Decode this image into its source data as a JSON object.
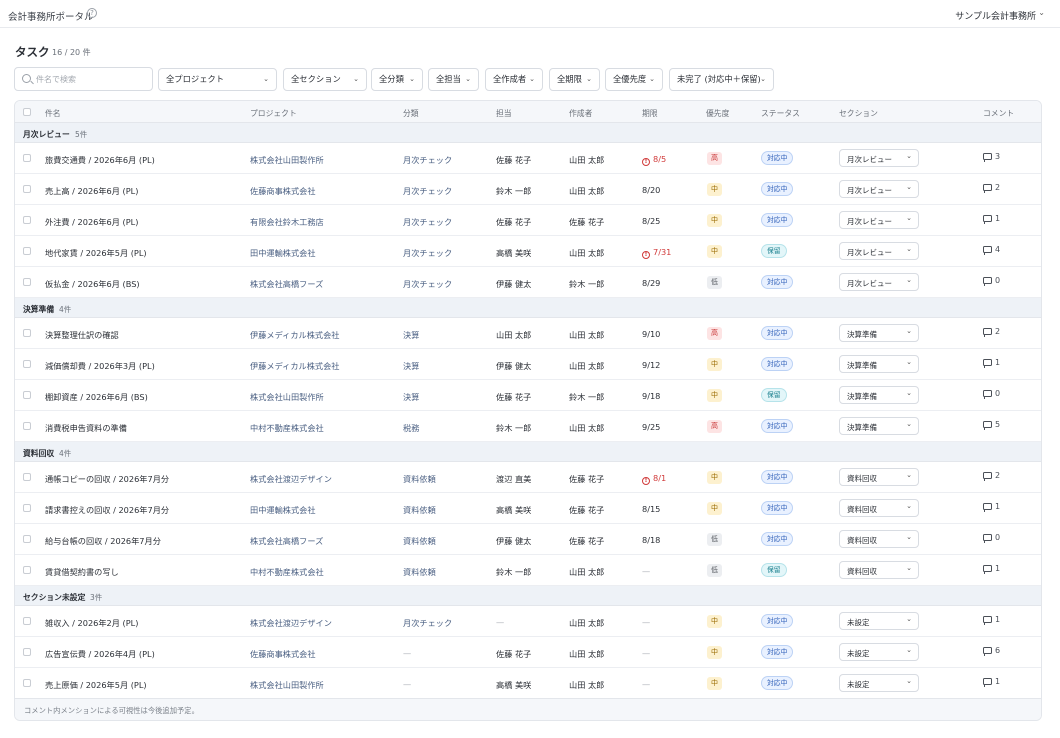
{
  "header": {
    "app_title": "会計事務所ポータル",
    "help_glyph": "?",
    "office_name": "サンプル会計事務所"
  },
  "page": {
    "title": "タスク",
    "count": "16 / 20 件"
  },
  "search": {
    "placeholder": "件名で検索",
    "value": ""
  },
  "filters": [
    {
      "label": "全プロジェクト"
    },
    {
      "label": "全セクション"
    },
    {
      "label": "全分類"
    },
    {
      "label": "全担当"
    },
    {
      "label": "全作成者"
    },
    {
      "label": "全期限"
    },
    {
      "label": "全優先度"
    },
    {
      "label": "未完了 (対応中＋保留)"
    }
  ],
  "columns": {
    "name": "件名",
    "project": "プロジェクト",
    "category": "分類",
    "assignee": "担当",
    "author": "作成者",
    "due": "期限",
    "priority": "優先度",
    "status": "ステータス",
    "section": "セクション",
    "comments": "コメント"
  },
  "groups": [
    {
      "label": "月次レビュー",
      "count": "5件",
      "rows": [
        {
          "name": "旅費交通費 / 2026年6月 (PL)",
          "project": "株式会社山田製作所",
          "category": "月次チェック",
          "assignee": "佐藤 花子",
          "author": "山田 太郎",
          "due": "8/5",
          "overdue": true,
          "priority": "高",
          "priority_level": "high",
          "status": "対応中",
          "status_type": "prog",
          "section": "月次レビュー",
          "comments": "3"
        },
        {
          "name": "売上高 / 2026年6月 (PL)",
          "project": "佐藤商事株式会社",
          "category": "月次チェック",
          "assignee": "鈴木 一郎",
          "author": "山田 太郎",
          "due": "8/20",
          "overdue": false,
          "priority": "中",
          "priority_level": "mid",
          "status": "対応中",
          "status_type": "prog",
          "section": "月次レビュー",
          "comments": "2"
        },
        {
          "name": "外注費 / 2026年6月 (PL)",
          "project": "有限会社鈴木工務店",
          "category": "月次チェック",
          "assignee": "佐藤 花子",
          "author": "佐藤 花子",
          "due": "8/25",
          "overdue": false,
          "priority": "中",
          "priority_level": "mid",
          "status": "対応中",
          "status_type": "prog",
          "section": "月次レビュー",
          "comments": "1"
        },
        {
          "name": "地代家賃 / 2026年5月 (PL)",
          "project": "田中運輸株式会社",
          "category": "月次チェック",
          "assignee": "高橋 美咲",
          "author": "山田 太郎",
          "due": "7/31",
          "overdue": true,
          "priority": "中",
          "priority_level": "mid",
          "status": "保留",
          "status_type": "hold",
          "section": "月次レビュー",
          "comments": "4"
        },
        {
          "name": "仮払金 / 2026年6月 (BS)",
          "project": "株式会社高橋フーズ",
          "category": "月次チェック",
          "assignee": "伊藤 健太",
          "author": "鈴木 一郎",
          "due": "8/29",
          "overdue": false,
          "priority": "低",
          "priority_level": "low",
          "status": "対応中",
          "status_type": "prog",
          "section": "月次レビュー",
          "comments": "0"
        }
      ]
    },
    {
      "label": "決算準備",
      "count": "4件",
      "rows": [
        {
          "name": "決算整理仕訳の確認",
          "project": "伊藤メディカル株式会社",
          "category": "決算",
          "assignee": "山田 太郎",
          "author": "山田 太郎",
          "due": "9/10",
          "overdue": false,
          "priority": "高",
          "priority_level": "high",
          "status": "対応中",
          "status_type": "prog",
          "section": "決算準備",
          "comments": "2"
        },
        {
          "name": "減価償却費 / 2026年3月 (PL)",
          "project": "伊藤メディカル株式会社",
          "category": "決算",
          "assignee": "伊藤 健太",
          "author": "山田 太郎",
          "due": "9/12",
          "overdue": false,
          "priority": "中",
          "priority_level": "mid",
          "status": "対応中",
          "status_type": "prog",
          "section": "決算準備",
          "comments": "1"
        },
        {
          "name": "棚卸資産 / 2026年6月 (BS)",
          "project": "株式会社山田製作所",
          "category": "決算",
          "assignee": "佐藤 花子",
          "author": "鈴木 一郎",
          "due": "9/18",
          "overdue": false,
          "priority": "中",
          "priority_level": "mid",
          "status": "保留",
          "status_type": "hold",
          "section": "決算準備",
          "comments": "0"
        },
        {
          "name": "消費税申告資料の準備",
          "project": "中村不動産株式会社",
          "category": "税務",
          "assignee": "鈴木 一郎",
          "author": "山田 太郎",
          "due": "9/25",
          "overdue": false,
          "priority": "高",
          "priority_level": "high",
          "status": "対応中",
          "status_type": "prog",
          "section": "決算準備",
          "comments": "5"
        }
      ]
    },
    {
      "label": "資料回収",
      "count": "4件",
      "rows": [
        {
          "name": "通帳コピーの回収 / 2026年7月分",
          "project": "株式会社渡辺デザイン",
          "category": "資料依頼",
          "assignee": "渡辺 直美",
          "author": "佐藤 花子",
          "due": "8/1",
          "overdue": true,
          "priority": "中",
          "priority_level": "mid",
          "status": "対応中",
          "status_type": "prog",
          "section": "資料回収",
          "comments": "2"
        },
        {
          "name": "請求書控えの回収 / 2026年7月分",
          "project": "田中運輸株式会社",
          "category": "資料依頼",
          "assignee": "高橋 美咲",
          "author": "佐藤 花子",
          "due": "8/15",
          "overdue": false,
          "priority": "中",
          "priority_level": "mid",
          "status": "対応中",
          "status_type": "prog",
          "section": "資料回収",
          "comments": "1"
        },
        {
          "name": "給与台帳の回収 / 2026年7月分",
          "project": "株式会社高橋フーズ",
          "category": "資料依頼",
          "assignee": "伊藤 健太",
          "author": "佐藤 花子",
          "due": "8/18",
          "overdue": false,
          "priority": "低",
          "priority_level": "low",
          "status": "対応中",
          "status_type": "prog",
          "section": "資料回収",
          "comments": "0"
        },
        {
          "name": "賃貸借契約書の写し",
          "project": "中村不動産株式会社",
          "category": "資料依頼",
          "assignee": "鈴木 一郎",
          "author": "山田 太郎",
          "due": "—",
          "overdue": false,
          "priority": "低",
          "priority_level": "low",
          "status": "保留",
          "status_type": "hold",
          "section": "資料回収",
          "comments": "1"
        }
      ]
    },
    {
      "label": "セクション未設定",
      "count": "3件",
      "rows": [
        {
          "name": "雑収入 / 2026年2月 (PL)",
          "project": "株式会社渡辺デザイン",
          "category": "月次チェック",
          "assignee": "—",
          "author": "山田 太郎",
          "due": "—",
          "overdue": false,
          "priority": "中",
          "priority_level": "mid",
          "status": "対応中",
          "status_type": "prog",
          "section": "未設定",
          "comments": "1"
        },
        {
          "name": "広告宣伝費 / 2026年4月 (PL)",
          "project": "佐藤商事株式会社",
          "category": "—",
          "assignee": "佐藤 花子",
          "author": "山田 太郎",
          "due": "—",
          "overdue": false,
          "priority": "中",
          "priority_level": "mid",
          "status": "対応中",
          "status_type": "prog",
          "section": "未設定",
          "comments": "6"
        },
        {
          "name": "売上原価 / 2026年5月 (PL)",
          "project": "株式会社山田製作所",
          "category": "—",
          "assignee": "高橋 美咲",
          "author": "山田 太郎",
          "due": "—",
          "overdue": false,
          "priority": "中",
          "priority_level": "mid",
          "status": "対応中",
          "status_type": "prog",
          "section": "未設定",
          "comments": "1"
        }
      ]
    }
  ],
  "footer": {
    "note": "コメント内メンションによる可視性は今後追加予定。"
  },
  "colors": {
    "priority_high": "#c62f2f",
    "priority_mid": "#9a6a00",
    "overdue": "#d13a3a",
    "status_in_progress": "#2f5fb8",
    "status_on_hold": "#167d8c"
  },
  "icons": {
    "search": "search-icon",
    "help": "help-icon",
    "chevron": "chevron-down-icon",
    "overdue": "alert-circle-icon",
    "comment": "comment-icon"
  }
}
